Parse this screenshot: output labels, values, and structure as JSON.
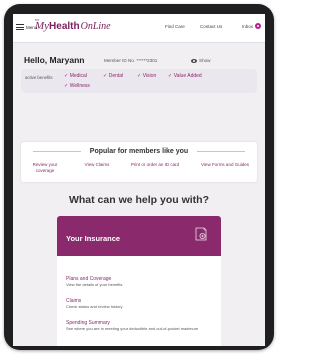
{
  "header": {
    "menu_label": "Menu",
    "logo_top": "MY",
    "logo_my": "My",
    "logo_health": "Health",
    "logo_online": "OnLine",
    "nav": [
      "Find Care",
      "Contact Us"
    ],
    "inbox_label": "Inbox"
  },
  "greeting": {
    "hello": "Hello, Maryann",
    "member_id": "Member ID No. ******2301",
    "show_label": "Show"
  },
  "benefits": {
    "label": "active benefits",
    "items": [
      "Medical",
      "Dental",
      "Vision",
      "Value Added",
      "Wellness"
    ]
  },
  "popular": {
    "title": "Popular for members like you",
    "links": [
      "Review your coverage",
      "View Claims",
      "Print or order an ID card",
      "View Forms and Guides"
    ]
  },
  "help_heading": "What can we help you with?",
  "insurance": {
    "title": "Your Insurance",
    "items": [
      {
        "title": "Plans and Coverage",
        "desc": "View the details of your benefits"
      },
      {
        "title": "Claims",
        "desc": "Check status and review history"
      },
      {
        "title": "Spending Summary",
        "desc": "See where you are in meeting your deductible and out-of-pocket maximum"
      }
    ]
  },
  "colors": {
    "brand": "#8a2a6c",
    "accent": "#b4238b",
    "background": "#f1eff2"
  },
  "icons": [
    "menu-icon",
    "eye-icon",
    "checkmark-icon",
    "insurance-card-icon",
    "inbox-badge-icon"
  ]
}
